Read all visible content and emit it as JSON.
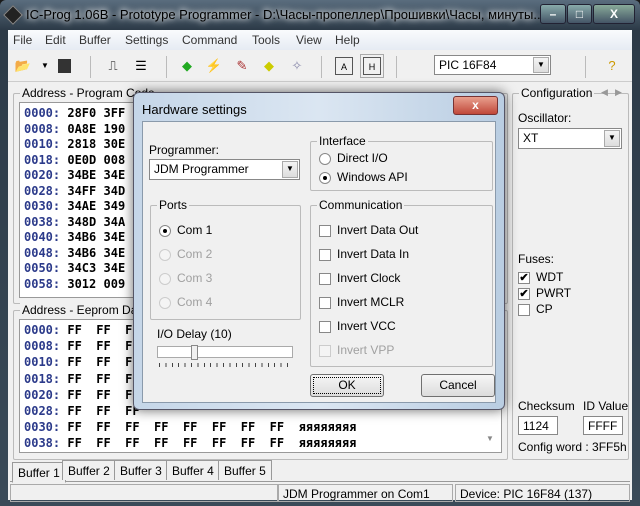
{
  "window": {
    "title": "IC-Prog 1.06B - Prototype Programmer - D:\\Часы-пропеллер\\Прошивки\\Часы, минуты...",
    "minimize": "–",
    "maximize": "□",
    "close": "X"
  },
  "menu": [
    "File",
    "Edit",
    "Buffer",
    "Settings",
    "Command",
    "Tools",
    "View",
    "Help"
  ],
  "toolbar": {
    "device": "PIC 16F84"
  },
  "program": {
    "title": "Address - Program Code",
    "rows": [
      [
        "0000:",
        "28F0",
        "3FF"
      ],
      [
        "0008:",
        "0A8E",
        "190"
      ],
      [
        "0010:",
        "2818",
        "30E"
      ],
      [
        "0018:",
        "0E0D",
        "008"
      ],
      [
        "0020:",
        "34BE",
        "34E"
      ],
      [
        "0028:",
        "34FF",
        "34D"
      ],
      [
        "0030:",
        "34AE",
        "349"
      ],
      [
        "0038:",
        "348D",
        "34A"
      ],
      [
        "0040:",
        "34B6",
        "34E"
      ],
      [
        "0048:",
        "34B6",
        "34E"
      ],
      [
        "0050:",
        "34C3",
        "34E"
      ],
      [
        "0058:",
        "3012",
        "009"
      ]
    ]
  },
  "eeprom": {
    "title": "Address - Eeprom Data",
    "rows": [
      [
        "0000:",
        "FF  FF  FF",
        ""
      ],
      [
        "0008:",
        "FF  FF  FF",
        ""
      ],
      [
        "0010:",
        "FF  FF  FF",
        ""
      ],
      [
        "0018:",
        "FF  FF  FF",
        ""
      ],
      [
        "0020:",
        "FF  FF  FF",
        ""
      ],
      [
        "0028:",
        "FF  FF  FF",
        ""
      ],
      [
        "0030:",
        "FF  FF  FF  FF  FF  FF  FF  FF",
        "яяяяяяяя"
      ],
      [
        "0038:",
        "FF  FF  FF  FF  FF  FF  FF  FF",
        "яяяяяяяя"
      ]
    ]
  },
  "config": {
    "title": "Configuration",
    "oscillator_label": "Oscillator:",
    "oscillator": "XT",
    "fuses_label": "Fuses:",
    "fuses": [
      {
        "label": "WDT",
        "checked": true
      },
      {
        "label": "PWRT",
        "checked": true
      },
      {
        "label": "CP",
        "checked": false
      }
    ],
    "checksum_label": "Checksum",
    "checksum": "1124",
    "id_label": "ID Value",
    "id_value": "FFFF",
    "config_word": "Config word : 3FF5h"
  },
  "tabs": [
    "Buffer 1",
    "Buffer 2",
    "Buffer 3",
    "Buffer 4",
    "Buffer 5"
  ],
  "status": {
    "programmer": "JDM Programmer on Com1",
    "device": "Device: PIC 16F84  (137)"
  },
  "dialog": {
    "title": "Hardware settings",
    "close": "x",
    "programmer_label": "Programmer:",
    "programmer": "JDM Programmer",
    "interface_title": "Interface",
    "interface": [
      {
        "label": "Direct I/O",
        "selected": false
      },
      {
        "label": "Windows API",
        "selected": true
      }
    ],
    "ports_title": "Ports",
    "ports": [
      {
        "label": "Com 1",
        "selected": true,
        "enabled": true
      },
      {
        "label": "Com 2",
        "enabled": false
      },
      {
        "label": "Com 3",
        "enabled": false
      },
      {
        "label": "Com 4",
        "enabled": false
      }
    ],
    "io_delay_label": "I/O Delay (10)",
    "io_delay": 10,
    "communication_title": "Communication",
    "communication": [
      {
        "label": "Invert Data Out",
        "enabled": true
      },
      {
        "label": "Invert Data In",
        "enabled": true
      },
      {
        "label": "Invert Clock",
        "enabled": true
      },
      {
        "label": "Invert MCLR",
        "enabled": true
      },
      {
        "label": "Invert VCC",
        "enabled": true
      },
      {
        "label": "Invert VPP",
        "enabled": false
      }
    ],
    "ok": "OK",
    "cancel": "Cancel"
  }
}
